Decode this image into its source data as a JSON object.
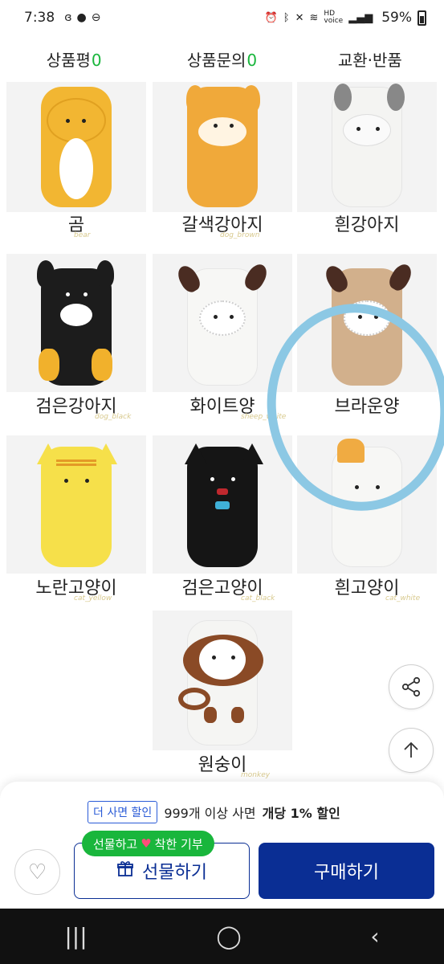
{
  "status_bar": {
    "time": "7:38",
    "battery": "59%",
    "left_icons": [
      "data-saver-icon",
      "chat-icon",
      "do-not-disturb-icon"
    ],
    "right_icons": [
      "alarm-icon",
      "bluetooth-icon",
      "mute-icon",
      "wifi-icon",
      "hd-voice-icon",
      "signal-icon",
      "battery-icon"
    ]
  },
  "tabs": [
    {
      "label": "상품평",
      "count": "0"
    },
    {
      "label": "상품문의",
      "count": "0"
    },
    {
      "label": "교환·반품",
      "count": ""
    }
  ],
  "products": [
    {
      "name": "곰",
      "color": "#f2b632"
    },
    {
      "name": "갈색강아지",
      "color": "#f0a93a"
    },
    {
      "name": "흰강아지",
      "color": "#f4f4f2"
    },
    {
      "name": "검은강아지",
      "color": "#1c1c1c"
    },
    {
      "name": "화이트양",
      "color": "#f7f7f5"
    },
    {
      "name": "브라운양",
      "color": "#d2b08c"
    },
    {
      "name": "노란고양이",
      "color": "#f6e04a"
    },
    {
      "name": "검은고양이",
      "color": "#151515"
    },
    {
      "name": "흰고양이",
      "color": "#f7f7f5"
    },
    {
      "name": "원숭이",
      "color": "#f5f5f3"
    }
  ],
  "purchase": {
    "discount_tag": "더 사면 할인",
    "discount_text": "999개 이상 사면",
    "discount_strong": "개당 1% 할인",
    "gift_bubble_before": "선물하고",
    "gift_bubble_after": "착한 기부",
    "gift_label": "선물하기",
    "buy_label": "구매하기"
  },
  "colors": {
    "accent_green": "#19b63c",
    "primary_navy": "#0a2e94",
    "annotation_blue": "#8cc8e4"
  }
}
